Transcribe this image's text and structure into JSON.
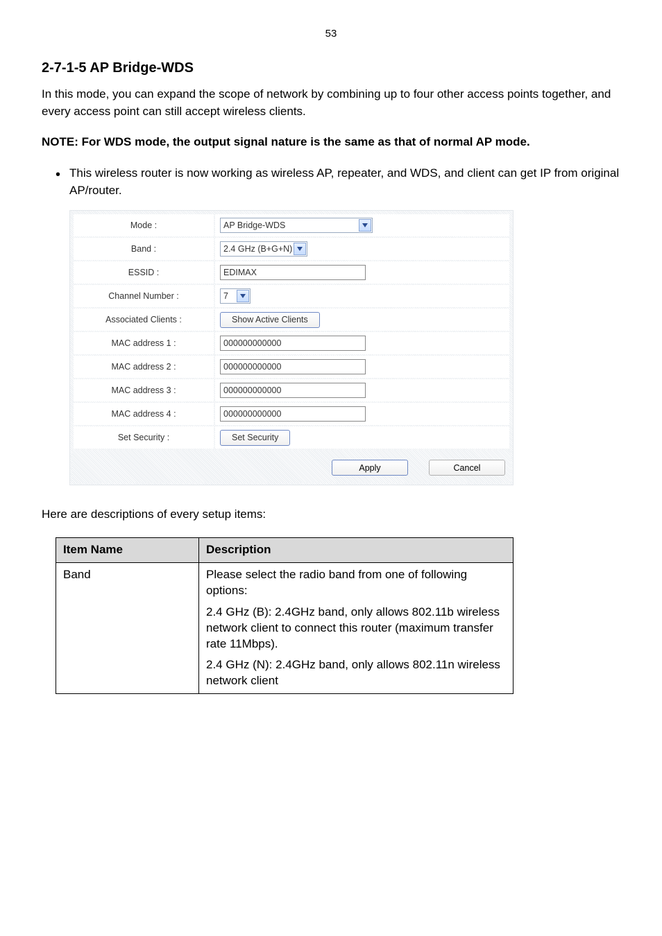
{
  "page_number": "53",
  "section": {
    "heading": "2-7-1-5 AP Bridge-WDS",
    "intro": "In this mode, you can expand the scope of network by combining up to four other access points together, and every access point can still accept wireless clients.",
    "note_bold": "NOTE: For WDS mode, the output signal nature is the same as that of normal AP mode.",
    "bullet": "This wireless router is now working as wireless AP, repeater, and WDS, and client can get IP from original AP/router."
  },
  "ui": {
    "labels": {
      "mode": "Mode :",
      "band": "Band :",
      "essid": "ESSID :",
      "channel": "Channel Number :",
      "assoc": "Associated Clients :",
      "mac1": "MAC address 1 :",
      "mac2": "MAC address 2 :",
      "mac3": "MAC address 3 :",
      "mac4": "MAC address 4 :",
      "sec": "Set Security :"
    },
    "values": {
      "mode": "AP Bridge-WDS",
      "band": "2.4 GHz (B+G+N)",
      "essid": "EDIMAX",
      "channel": "7",
      "mac1": "000000000000",
      "mac2": "000000000000",
      "mac3": "000000000000",
      "mac4": "000000000000"
    },
    "buttons": {
      "show_active": "Show Active Clients",
      "set_security": "Set Security",
      "apply": "Apply",
      "cancel": "Cancel"
    }
  },
  "desc": {
    "intro": "Here are descriptions of every setup items:",
    "header_item": "Item Name",
    "header_desc": "Description",
    "band_name": "Band",
    "band_desc": "Please select the radio band from one of following options:",
    "band_24b": "2.4 GHz (B): 2.4GHz band, only allows 802.11b wireless network client to connect this router (maximum transfer rate 11Mbps).",
    "band_24n": "2.4 GHz (N): 2.4GHz band, only allows 802.11n wireless network client"
  }
}
